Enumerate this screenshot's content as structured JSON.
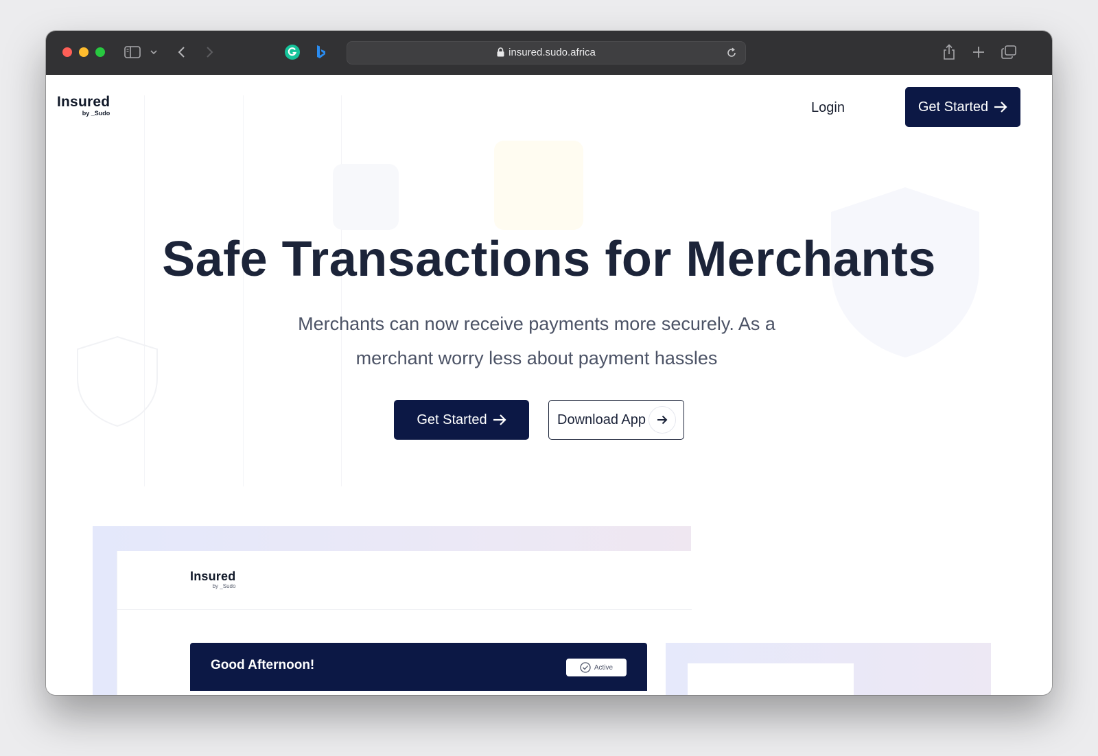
{
  "browser": {
    "url": "insured.sudo.africa"
  },
  "nav": {
    "logo_main": "Insured",
    "logo_sub": "by _Sudo",
    "login_label": "Login",
    "cta_label": "Get Started"
  },
  "hero": {
    "title": "Safe Transactions for Merchants",
    "subtitle": "Merchants can now receive payments more securely. As a merchant worry less about payment hassles",
    "primary_cta": "Get Started",
    "secondary_cta": "Download App"
  },
  "preview": {
    "logo_main": "Insured",
    "logo_sub": "by _Sudo",
    "greeting": "Good Afternoon!",
    "status_badge": "Active"
  },
  "colors": {
    "brand_navy": "#0c1845",
    "title_text": "#1c2439",
    "titlebar": "#323234"
  }
}
